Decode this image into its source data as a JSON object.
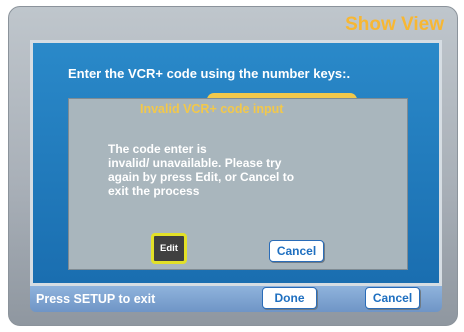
{
  "header": {
    "title": "Show View"
  },
  "main": {
    "prompt": "Enter the VCR+ code using the  number keys:."
  },
  "dialog": {
    "title": "Invalid VCR+ code input",
    "message": "The code enter is\ninvalid/ unavailable. Please try\nagain by press Edit, or Cancel to\nexit the process",
    "edit_label": "Edit",
    "cancel_label": "Cancel"
  },
  "footer": {
    "hint": "Press SETUP to exit",
    "done_label": "Done",
    "cancel_label": "Cancel"
  },
  "colors": {
    "accent": "#f7b733",
    "panel": "#1a6eb0",
    "dialog": "#a9b6bd",
    "focus": "#e2e028"
  }
}
